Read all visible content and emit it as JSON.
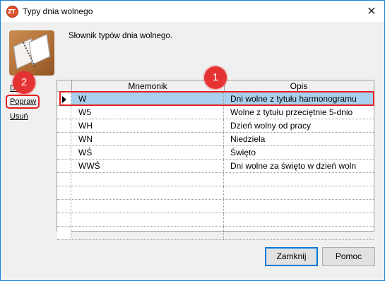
{
  "window": {
    "title": "Typy dnia wolnego",
    "app_icon_text": "ZT",
    "close_glyph": "✕"
  },
  "description": "Słownik typów dnia wolnego.",
  "side_actions": {
    "add": "Dodaj",
    "edit": "Popraw",
    "delete": "Usuń"
  },
  "grid": {
    "columns": [
      "Mnemonik",
      "Opis"
    ],
    "rows": [
      {
        "mnemonik": "W",
        "opis": "Dni wolne z tytułu harmonogramu",
        "selected": true
      },
      {
        "mnemonik": "W5",
        "opis": "Wolne z tytułu przeciętnie 5-dnio",
        "selected": false
      },
      {
        "mnemonik": "WH",
        "opis": "Dzień wolny od pracy",
        "selected": false
      },
      {
        "mnemonik": "WN",
        "opis": "Niedziela",
        "selected": false
      },
      {
        "mnemonik": "WŚ",
        "opis": "Święto",
        "selected": false
      },
      {
        "mnemonik": "WWŚ",
        "opis": "Dni wolne za święto w dzień woln",
        "selected": false
      }
    ],
    "empty_rows": 5
  },
  "annotations": {
    "badge_1": "1",
    "badge_2": "2",
    "color": "#e51f1f"
  },
  "buttons": {
    "close": "Zamknij",
    "help": "Pomoc"
  },
  "colors": {
    "selection": "#a9d1ef",
    "window_border": "#1883d7",
    "button_focus": "#0078d7"
  }
}
